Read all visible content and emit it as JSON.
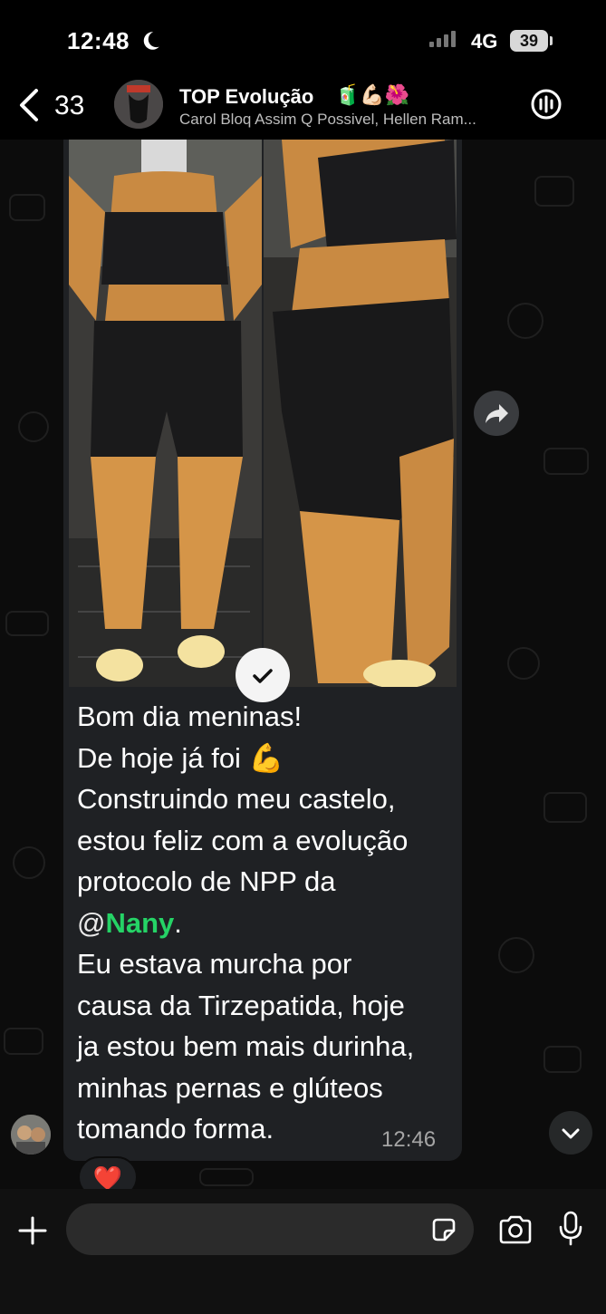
{
  "status_bar": {
    "time": "12:48",
    "network": "4G",
    "battery": "39"
  },
  "header": {
    "back_count": "33",
    "title": "TOP Evolução",
    "title_emojis": "🧃💪🏻🌺",
    "subtitle": "Carol Bloq Assim Q Possivel, Hellen Ram..."
  },
  "message": {
    "lines": [
      "Bom dia meninas!",
      "De hoje já foi 💪",
      "Construindo meu castelo,",
      "estou feliz com a evolução",
      "protocolo de NPP da"
    ],
    "mention_at": "@",
    "mention_name": "Nany",
    "mention_suffix": ".",
    "lines_after": [
      "Eu estava murcha por",
      "causa da Tirzepatida, hoje",
      "ja estou bem mais durinha,",
      "minhas  pernas e glúteos",
      "tomando forma."
    ],
    "time": "12:46",
    "reaction": "❤️"
  },
  "icons": {
    "back": "chevron-left-icon",
    "call": "group-call-icon",
    "forward": "forward-icon",
    "scroll": "chevron-down-icon",
    "plus": "plus-icon",
    "sticker": "sticker-icon",
    "camera": "camera-icon",
    "mic": "microphone-icon"
  },
  "colors": {
    "mention": "#25d366",
    "bubble": "#1f2124",
    "background": "#0c0c0c"
  }
}
